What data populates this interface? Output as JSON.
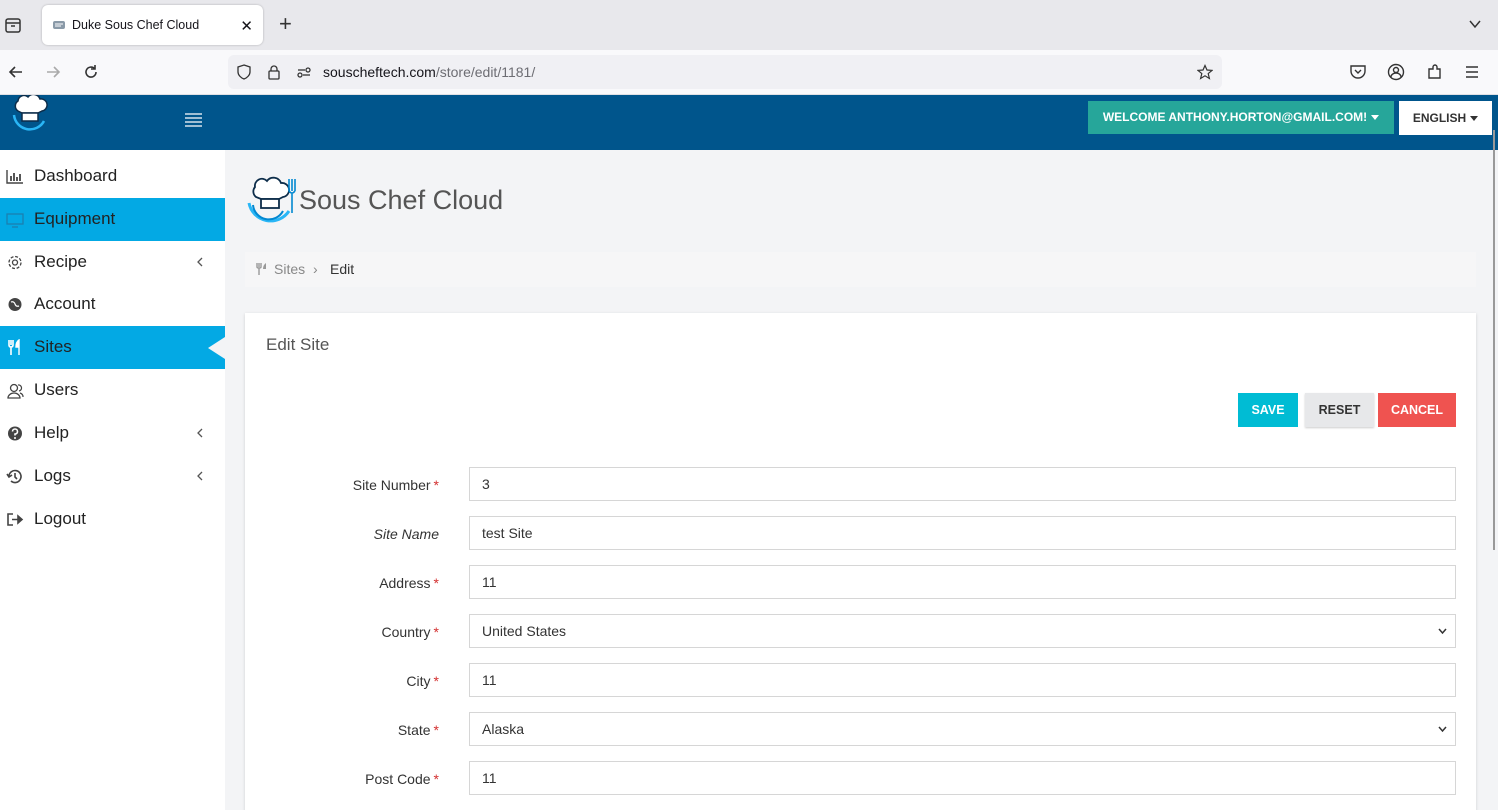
{
  "browser": {
    "tab_title": "Duke Sous Chef Cloud",
    "tab_close": "✕",
    "new_tab": "+",
    "url_domain": "souscheftech.com",
    "url_path": "/store/edit/1181/"
  },
  "header": {
    "welcome": "WELCOME ANTHONY.HORTON@GMAIL.COM!",
    "language": "ENGLISH"
  },
  "sidebar": {
    "items": [
      {
        "label": "Dashboard",
        "icon": "bar-chart-icon"
      },
      {
        "label": "Equipment",
        "icon": "monitor-icon"
      },
      {
        "label": "Recipe",
        "icon": "gear-icon"
      },
      {
        "label": "Account",
        "icon": "globe-icon"
      },
      {
        "label": "Sites",
        "icon": "cutlery-icon"
      },
      {
        "label": "Users",
        "icon": "users-icon"
      },
      {
        "label": "Help",
        "icon": "question-circle-icon"
      },
      {
        "label": "Logs",
        "icon": "history-icon"
      },
      {
        "label": "Logout",
        "icon": "sign-out-icon"
      }
    ]
  },
  "brand": {
    "name": "Sous Chef Cloud"
  },
  "breadcrumb": {
    "parent": "Sites",
    "separator": "›",
    "current": "Edit"
  },
  "form": {
    "title": "Edit Site",
    "buttons": {
      "save": "SAVE",
      "reset": "RESET",
      "cancel": "CANCEL"
    },
    "required_mark": "*",
    "fields": {
      "site_number": {
        "label": "Site Number",
        "value": "3"
      },
      "site_name": {
        "label": "Site Name",
        "value": "test Site"
      },
      "address": {
        "label": "Address",
        "value": "11"
      },
      "country": {
        "label": "Country",
        "value": "United States"
      },
      "city": {
        "label": "City",
        "value": "11"
      },
      "state": {
        "label": "State",
        "value": "Alaska"
      },
      "post_code": {
        "label": "Post Code",
        "value": "11"
      }
    }
  },
  "colors": {
    "header_bg": "#00558c",
    "active_nav": "#03a9e4",
    "welcome_bg": "#26a69a",
    "save_bg": "#00bcd4",
    "cancel_bg": "#ef5350"
  }
}
